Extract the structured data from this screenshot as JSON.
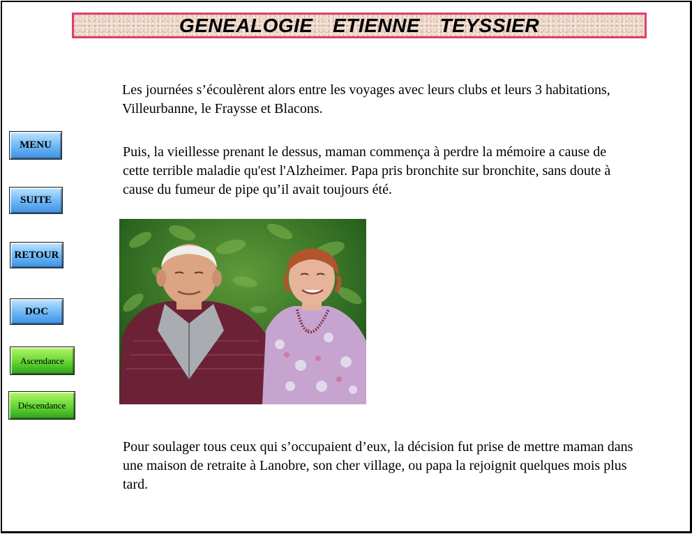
{
  "header": {
    "title": "GENEALOGIE  ETIENNE  TEYSSIER"
  },
  "nav": {
    "menu": "MENU",
    "suite": "SUITE",
    "retour": "RETOUR",
    "doc": "DOC",
    "ascendance": "Ascendance",
    "descendance": "Déscendance"
  },
  "content": {
    "paragraph_1": "Les journées s’écoulèrent alors entre les voyages avec leurs clubs et leurs 3 habitations, Villeurbanne, le Fraysse et Blacons.",
    "paragraph_2": "Puis, la vieillesse prenant le dessus, maman commença à perdre la mémoire a cause de cette terrible maladie qu'est l'Alzheimer. Papa pris bronchite sur bronchite, sans doute à cause du fumeur de pipe qu’il avait toujours été.",
    "paragraph_3": "Pour soulager tous ceux qui s’occupaient d’eux, la décision fut prise de mettre maman dans une maison de retraite à Lanobre, son cher village, ou papa la rejoignit quelques mois plus tard."
  },
  "colors": {
    "title_border": "#e23c6e",
    "blue_button": "#6ab6f6",
    "green_button": "#62d633"
  }
}
